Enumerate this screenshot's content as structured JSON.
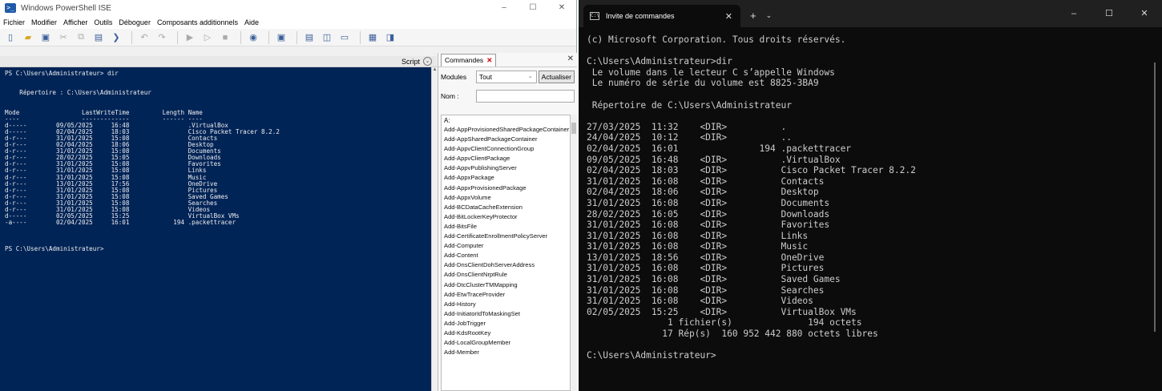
{
  "ise": {
    "title": "Windows PowerShell ISE",
    "app_icon": "powershell-icon",
    "window_controls": [
      "–",
      "☐",
      "✕"
    ],
    "menu": [
      "Fichier",
      "Modifier",
      "Afficher",
      "Outils",
      "Déboguer",
      "Composants additionnels",
      "Aide"
    ],
    "script_label": "Script",
    "console_lines": [
      "PS C:\\Users\\Administrateur> dir",
      "",
      "",
      "    Répertoire : C:\\Users\\Administrateur",
      "",
      "",
      "Mode                 LastWriteTime         Length Name",
      "----                 -------------         ------ ----",
      "d-----        09/05/2025     16:48                .VirtualBox",
      "d-----        02/04/2025     18:03                Cisco Packet Tracer 8.2.2",
      "d-r---        31/01/2025     15:08                Contacts",
      "d-r---        02/04/2025     18:06                Desktop",
      "d-r---        31/01/2025     15:08                Documents",
      "d-r---        28/02/2025     15:05                Downloads",
      "d-r---        31/01/2025     15:08                Favorites",
      "d-r---        31/01/2025     15:08                Links",
      "d-r---        31/01/2025     15:08                Music",
      "d-r---        13/01/2025     17:56                OneDrive",
      "d-r---        31/01/2025     15:08                Pictures",
      "d-r---        31/01/2025     15:08                Saved Games",
      "d-r---        31/01/2025     15:08                Searches",
      "d-r---        31/01/2025     15:08                Videos",
      "d-----        02/05/2025     15:25                VirtualBox VMs",
      "-a----        02/04/2025     16:01            194 .packettracer",
      "",
      "",
      "",
      "PS C:\\Users\\Administrateur>"
    ],
    "commands": {
      "tab_label": "Commandes",
      "modules_label": "Modules",
      "modules_value": "Tout",
      "refresh_button": "Actualiser",
      "name_label": "Nom :",
      "list_header": "A:",
      "items": [
        "Add-AppProvisionedSharedPackageContainer",
        "Add-AppSharedPackageContainer",
        "Add-AppvClientConnectionGroup",
        "Add-AppvClientPackage",
        "Add-AppvPublishingServer",
        "Add-AppxPackage",
        "Add-AppxProvisionedPackage",
        "Add-AppxVolume",
        "Add-BCDataCacheExtension",
        "Add-BitLockerKeyProtector",
        "Add-BitsFile",
        "Add-CertificateEnrollmentPolicyServer",
        "Add-Computer",
        "Add-Content",
        "Add-DnsClientDohServerAddress",
        "Add-DnsClientNrptRule",
        "Add-DtcClusterTMMapping",
        "Add-EtwTraceProvider",
        "Add-History",
        "Add-InitiatorIdToMaskingSet",
        "Add-JobTrigger",
        "Add-KdsRootKey",
        "Add-LocalGroupMember",
        "Add-Member"
      ]
    }
  },
  "terminal": {
    "tab_title": "Invite de commandes",
    "new_tab": "+",
    "dropdown": "⌄",
    "window_controls": [
      "–",
      "☐",
      "✕"
    ],
    "lines": [
      "(c) Microsoft Corporation. Tous droits réservés.",
      "",
      "C:\\Users\\Administrateur>dir",
      " Le volume dans le lecteur C s’appelle Windows",
      " Le numéro de série du volume est 8825-3BA9",
      "",
      " Répertoire de C:\\Users\\Administrateur",
      "",
      "27/03/2025  11:32    <DIR>          .",
      "24/04/2025  10:12    <DIR>          ..",
      "02/04/2025  16:01               194 .packettracer",
      "09/05/2025  16:48    <DIR>          .VirtualBox",
      "02/04/2025  18:03    <DIR>          Cisco Packet Tracer 8.2.2",
      "31/01/2025  16:08    <DIR>          Contacts",
      "02/04/2025  18:06    <DIR>          Desktop",
      "31/01/2025  16:08    <DIR>          Documents",
      "28/02/2025  16:05    <DIR>          Downloads",
      "31/01/2025  16:08    <DIR>          Favorites",
      "31/01/2025  16:08    <DIR>          Links",
      "31/01/2025  16:08    <DIR>          Music",
      "13/01/2025  18:56    <DIR>          OneDrive",
      "31/01/2025  16:08    <DIR>          Pictures",
      "31/01/2025  16:08    <DIR>          Saved Games",
      "31/01/2025  16:08    <DIR>          Searches",
      "31/01/2025  16:08    <DIR>          Videos",
      "02/05/2025  15:25    <DIR>          VirtualBox VMs",
      "               1 fichier(s)              194 octets",
      "              17 Rép(s)  160 952 442 880 octets libres",
      "",
      "C:\\Users\\Administrateur>"
    ]
  },
  "colors": {
    "ise_console_bg": "#012456",
    "terminal_bg": "#0c0c0c",
    "terminal_text": "#cccccc"
  }
}
